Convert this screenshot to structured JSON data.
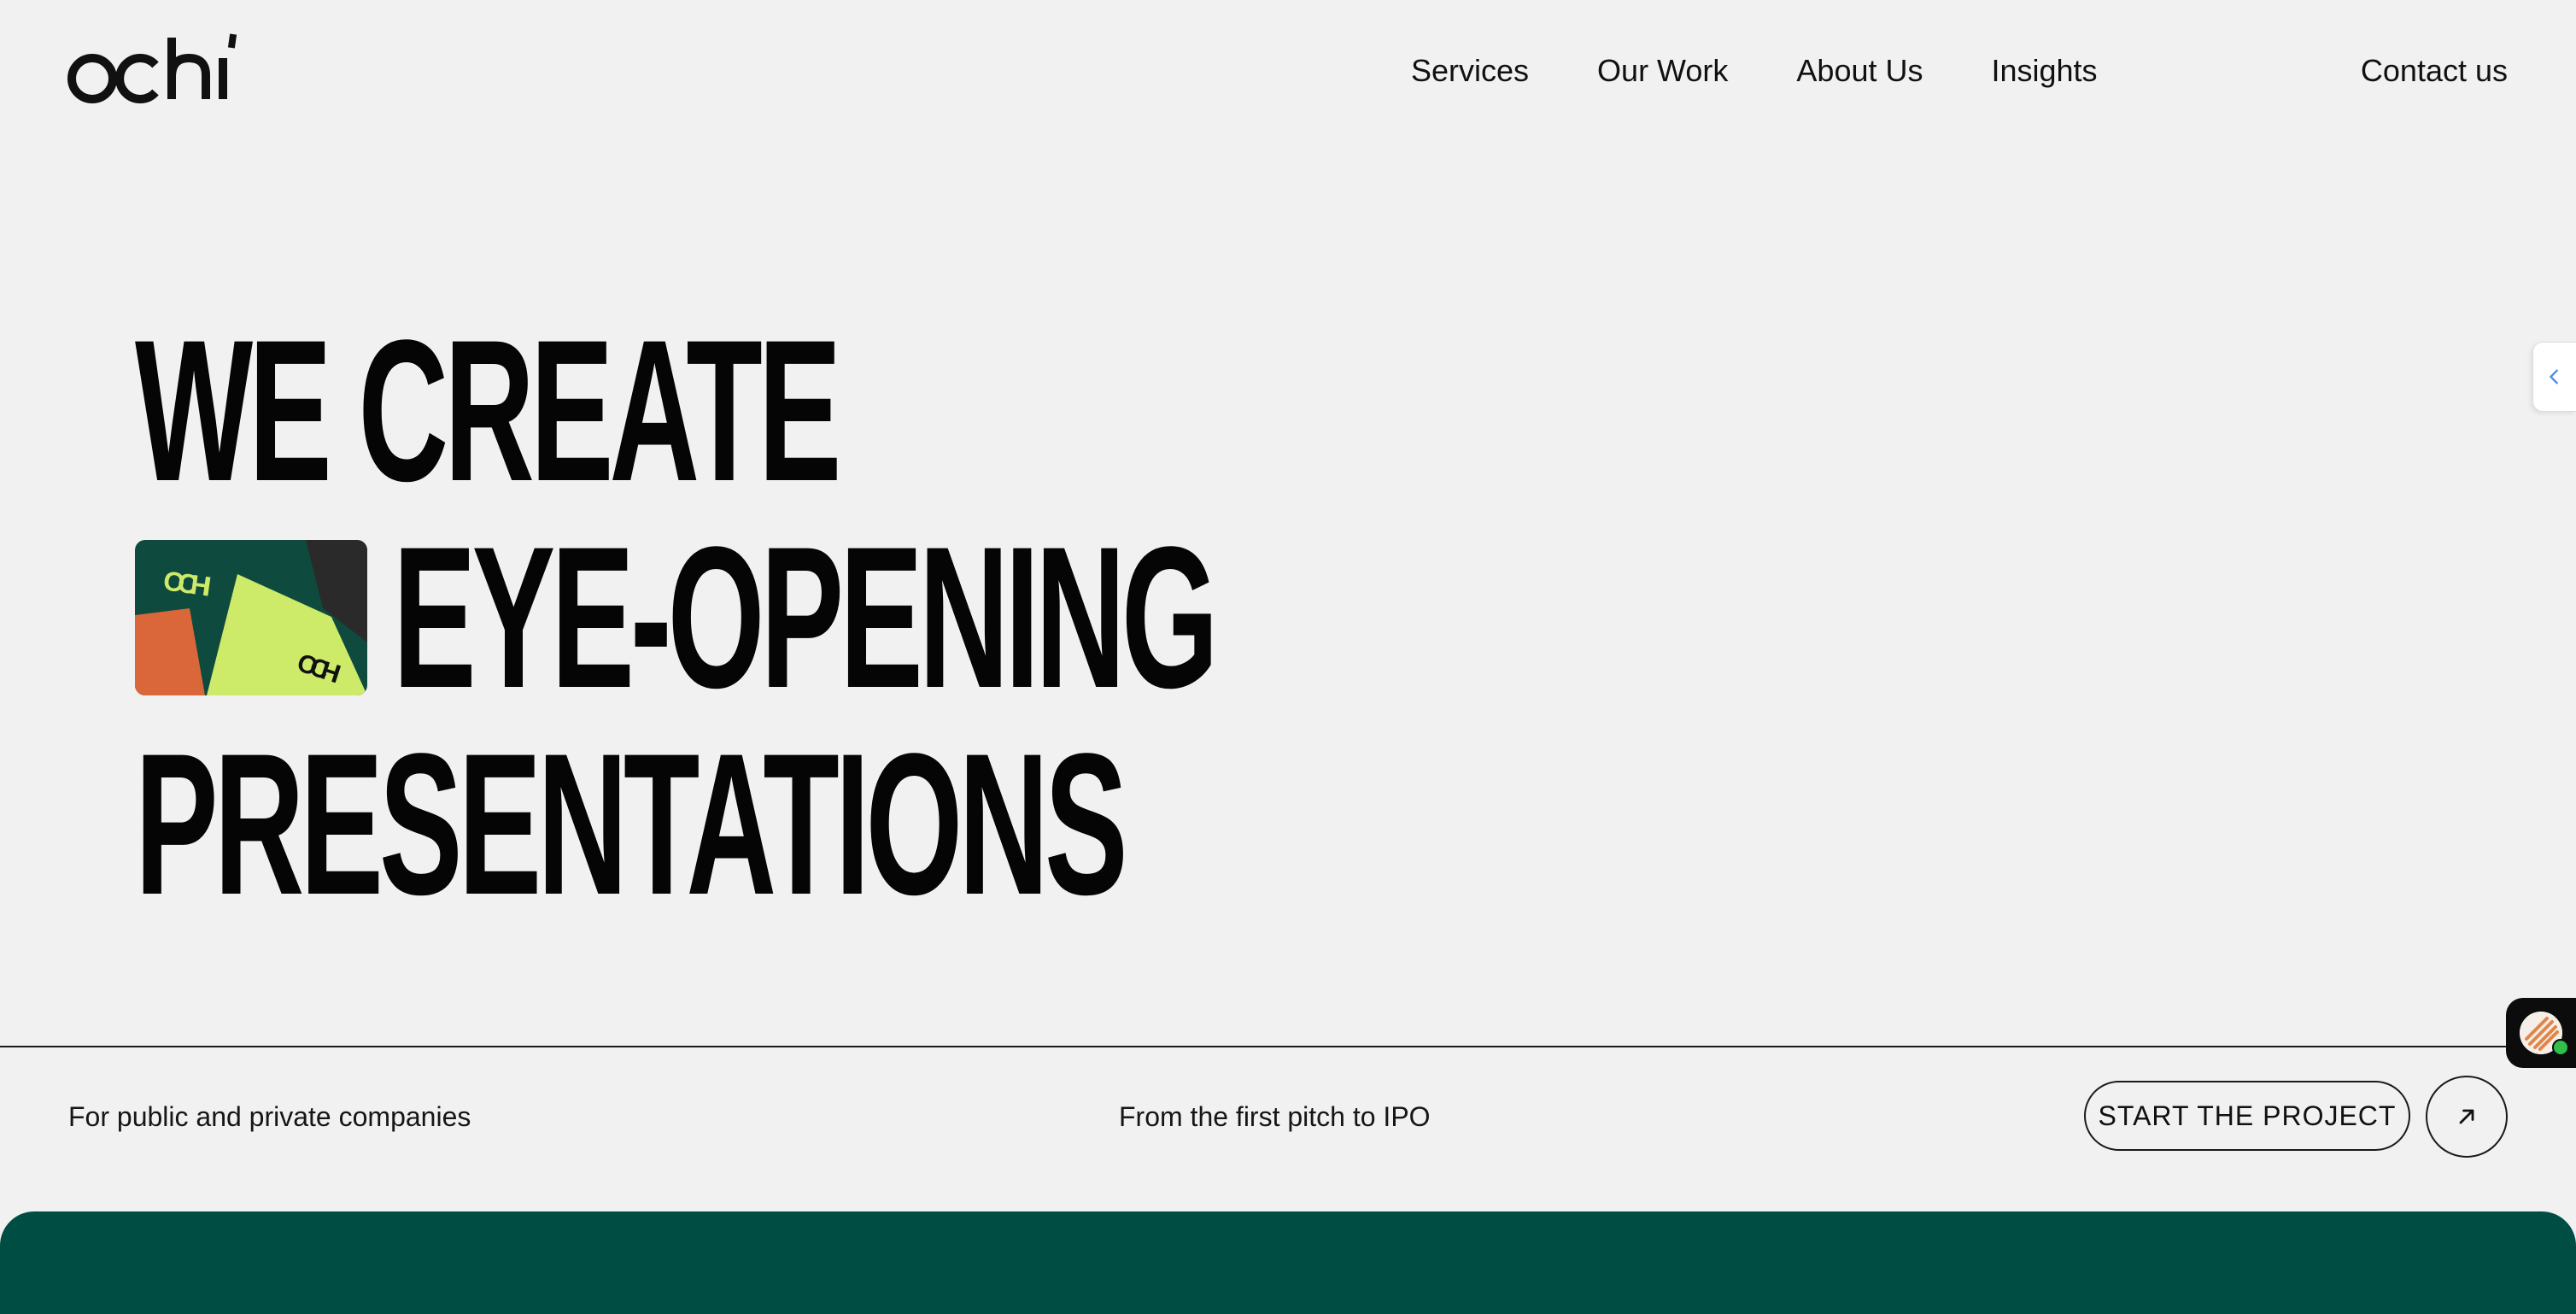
{
  "brand": {
    "logo_text": "ochi"
  },
  "nav": {
    "items": [
      {
        "label": "Services"
      },
      {
        "label": "Our Work"
      },
      {
        "label": "About Us"
      },
      {
        "label": "Insights"
      }
    ],
    "contact_label": "Contact us"
  },
  "hero": {
    "line1": "WE CREATE",
    "line2": "EYE-OPENING",
    "line3": "PRESENTATIONS",
    "thumbnail_text": "ochi"
  },
  "footer_strip": {
    "tagline_1": "For public and private companies",
    "tagline_2": "From the first pitch to IPO",
    "cta_label": "START THE PROJECT"
  },
  "icons": {
    "side_handle": "chevron-left-icon",
    "cta_arrow": "arrow-up-right-icon",
    "chat": "chat-avatar-icon"
  },
  "colors": {
    "background": "#f1f1f1",
    "text": "#111111",
    "green_section": "#004d43",
    "thumb_lime": "#cdea68",
    "thumb_orange": "#d9673a",
    "thumb_dark_green": "#0f4a3f",
    "online_dot": "#2fbf4a"
  }
}
